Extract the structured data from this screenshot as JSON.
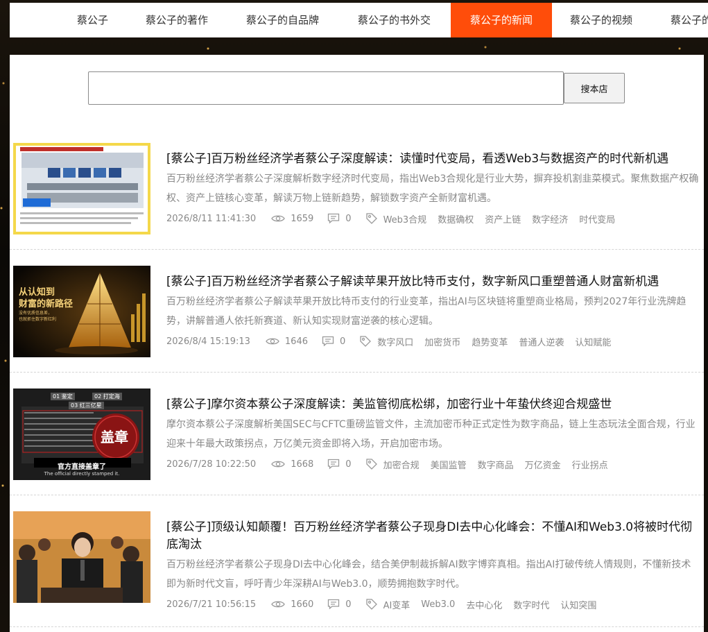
{
  "nav": {
    "items": [
      {
        "label": "蔡公子",
        "active": false
      },
      {
        "label": "蔡公子的著作",
        "active": false
      },
      {
        "label": "蔡公子的自品牌",
        "active": false
      },
      {
        "label": "蔡公子的书外交",
        "active": false
      },
      {
        "label": "蔡公子的新闻",
        "active": true
      },
      {
        "label": "蔡公子的视频",
        "active": false
      },
      {
        "label": "蔡公子的",
        "active": false
      }
    ],
    "active_color": "#ff4d0a"
  },
  "search": {
    "value": "",
    "button_label": "搜本店"
  },
  "articles": [
    {
      "title": "[蔡公子]百万粉丝经济学者蔡公子深度解读：读懂时代变局，看透Web3与数据资产的时代新机遇",
      "summary": "百万粉丝经济学者蔡公子深度解析数字经济时代变局，指出Web3合规化是行业大势，摒弃投机割韭菜模式。聚焦数据产权确权、资产上链核心变革，解读万物上链新趋势，解锁数字资产全新财富机遇。",
      "date": "2026/8/11 11:41:30",
      "views": "1659",
      "comments": "0",
      "tags": [
        "Web3合规",
        "数据确权",
        "资产上链",
        "数字经济",
        "时代变局"
      ]
    },
    {
      "title": "[蔡公子]百万粉丝经济学者蔡公子解读苹果开放比特币支付，数字新风口重塑普通人财富新机遇",
      "summary": "百万粉丝经济学者蔡公子解读苹果开放比特币支付的行业变革，指出AI与区块链将重塑商业格局，预判2027年行业洗牌趋势，讲解普通人依托新赛道、新认知实现财富逆袭的核心逻辑。",
      "date": "2026/8/4 15:19:13",
      "views": "1646",
      "comments": "0",
      "tags": [
        "数字风口",
        "加密货币",
        "趋势变革",
        "普通人逆袭",
        "认知赋能"
      ],
      "image_text": {
        "line1": "从认知到",
        "line2": "财富的新路径",
        "line3": "没有优质信息差，",
        "line4": "也就抓住数字新红利"
      }
    },
    {
      "title": "[蔡公子]摩尔资本蔡公子深度解读：美监管彻底松绑，加密行业十年蛰伏终迎合规盛世",
      "summary": "摩尔资本蔡公子深度解析美国SEC与CFTC重磅监管文件，主流加密币种正式定性为数字商品，链上生态玩法全面合规，行业迎来十年最大政策拐点，万亿美元资金即将入场，开启加密市场。",
      "date": "2026/7/28 10:22:50",
      "views": "1668",
      "comments": "0",
      "tags": [
        "加密合规",
        "美国监管",
        "数字商品",
        "万亿资金",
        "行业拐点"
      ],
      "image_text": {
        "stamp": "盖章",
        "caption_cn": "官方直接盖章了",
        "caption_en": "The official directly stamped it.",
        "tab1": "01 鉴定",
        "tab2": "02 打定海",
        "tab3": "03 红三亿星"
      }
    },
    {
      "title": "[蔡公子]顶级认知颠覆！百万粉丝经济学者蔡公子现身DI去中心化峰会：不懂AI和Web3.0将被时代彻底淘汰",
      "summary": "百万粉丝经济学者蔡公子现身DI去中心化峰会，结合美伊制裁拆解AI数字博弈真相。指出AI打破传统人情规则，不懂新技术即为新时代文盲，呼吁青少年深耕AI与Web3.0，顺势拥抱数字时代。",
      "date": "2026/7/21 10:56:15",
      "views": "1660",
      "comments": "0",
      "tags": [
        "AI变革",
        "Web3.0",
        "去中心化",
        "数字时代",
        "认知突围"
      ]
    }
  ]
}
